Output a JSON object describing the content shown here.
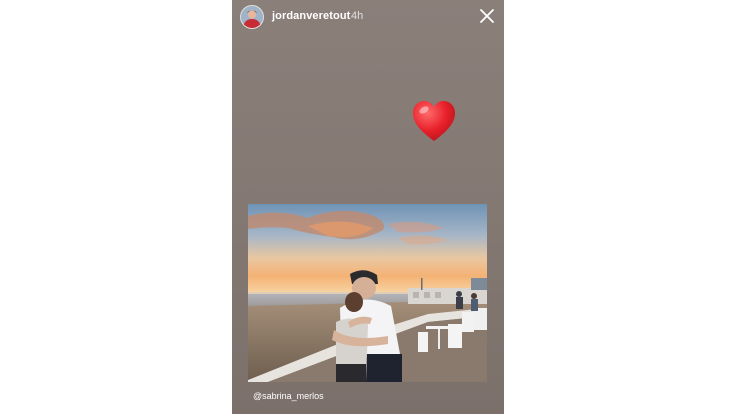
{
  "story": {
    "username": "jordanveretout",
    "time_ago": "4h",
    "mention": "@sabrina_merlos"
  },
  "icons": {
    "close": "close-icon",
    "heart": "heart-icon"
  },
  "colors": {
    "background": "#ffffff",
    "story_bg": "#847873",
    "heart": "#e8212b",
    "text": "#ffffff"
  }
}
